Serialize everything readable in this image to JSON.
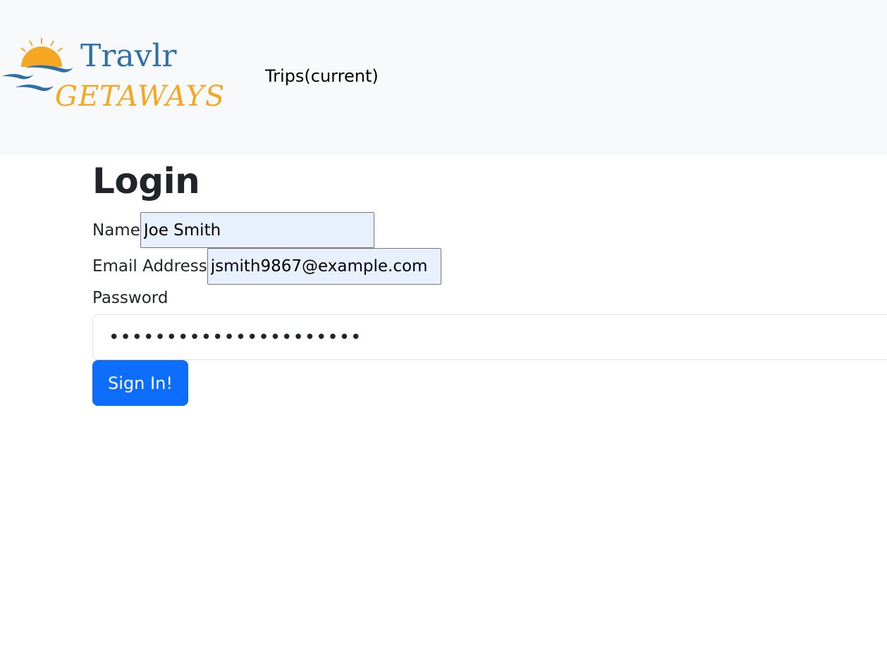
{
  "navbar": {
    "logo": {
      "icon": "travlr-getaways-logo",
      "brand_top": "Travlr",
      "brand_bottom": "GETAWAYS",
      "colors": {
        "sun": "#f5a623",
        "brand_top": "#2f6fa8",
        "brand_bottom": "#f5a623",
        "birds": "#2f6fa8"
      }
    },
    "trips_link": "Trips(current)"
  },
  "page": {
    "title": "Login"
  },
  "form": {
    "name": {
      "label": "Name",
      "value": "Joe Smith"
    },
    "email": {
      "label": "Email Address",
      "value": "jsmith9867@example.com"
    },
    "password": {
      "label": "Password",
      "value": "••••••••••••••••••••••"
    },
    "submit_label": "Sign In!"
  },
  "colors": {
    "navbar_bg": "#f8f9fa",
    "autofill_bg": "#e8f0fe",
    "primary_button": "#0d6efd",
    "text": "#212529"
  }
}
